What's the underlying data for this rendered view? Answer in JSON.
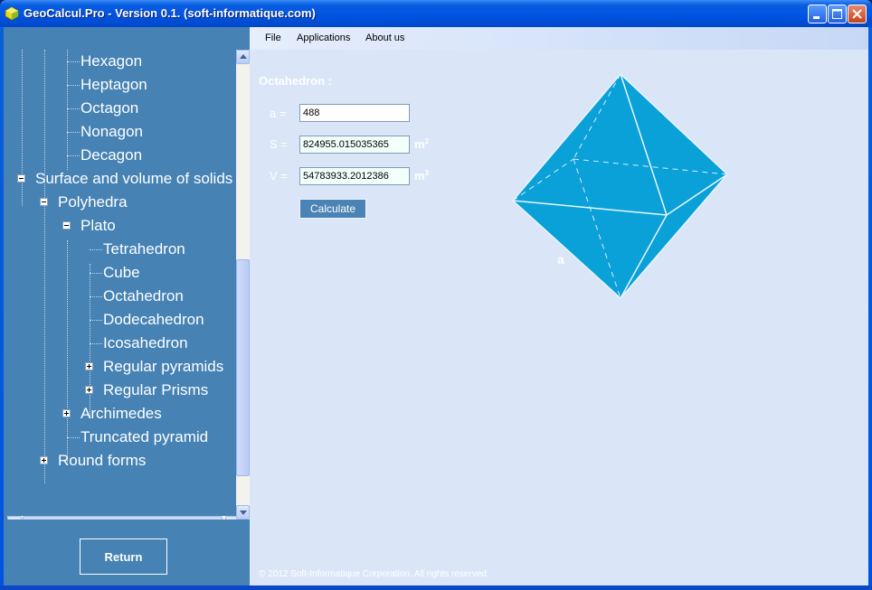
{
  "window": {
    "title": "GeoCalcul.Pro - Version 0.1. (soft-informatique.com)"
  },
  "tree": {
    "items": [
      {
        "label": "Hexagon"
      },
      {
        "label": "Heptagon"
      },
      {
        "label": "Octagon"
      },
      {
        "label": "Nonagon"
      },
      {
        "label": "Decagon"
      },
      {
        "label": "Surface and volume of solids"
      },
      {
        "label": "Polyhedra"
      },
      {
        "label": "Plato"
      },
      {
        "label": "Tetrahedron"
      },
      {
        "label": "Cube"
      },
      {
        "label": "Octahedron"
      },
      {
        "label": "Dodecahedron"
      },
      {
        "label": "Icosahedron"
      },
      {
        "label": "Regular pyramids"
      },
      {
        "label": "Regular Prisms"
      },
      {
        "label": "Archimedes"
      },
      {
        "label": "Truncated pyramid"
      },
      {
        "label": "Round forms"
      }
    ]
  },
  "left": {
    "return_label": "Return"
  },
  "menu": {
    "file": "File",
    "applications": "Applications",
    "about": "About us"
  },
  "form": {
    "title": "Octahedron :",
    "a_label": "a =",
    "a_value": "488",
    "s_label": "S =",
    "s_value": "824955.015035365",
    "s_unit": "m",
    "s_unit_exp": "2",
    "v_label": "V =",
    "v_value": "54783933.2012386",
    "v_unit": "m",
    "v_unit_exp": "3",
    "calculate_label": "Calculate"
  },
  "diagram": {
    "edge_label": "a",
    "fill_color": "#0aa0d8"
  },
  "footer": {
    "copyright": "© 2012 Soft-Informatique Corporation. All rights reserved."
  }
}
